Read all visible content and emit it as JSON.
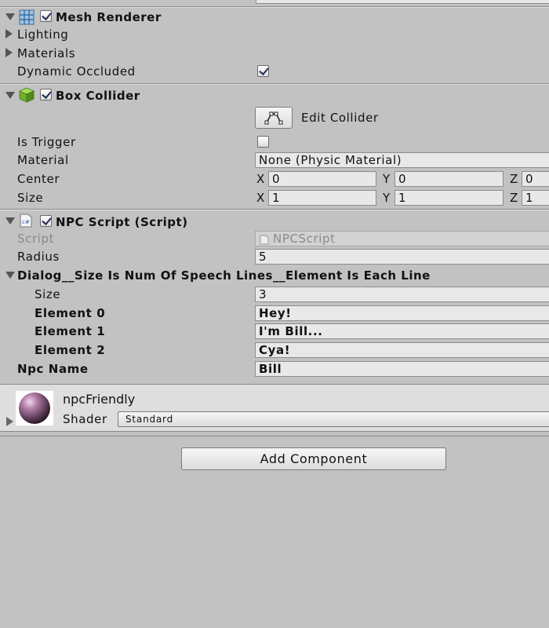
{
  "mesh_renderer": {
    "title": "Mesh Renderer",
    "enabled": true,
    "lighting_label": "Lighting",
    "materials_label": "Materials",
    "dynamic_occluded_label": "Dynamic Occluded",
    "dynamic_occluded": true
  },
  "box_collider": {
    "title": "Box Collider",
    "enabled": true,
    "edit_collider_label": "Edit Collider",
    "is_trigger_label": "Is Trigger",
    "is_trigger": false,
    "material_label": "Material",
    "material_value": "None (Physic Material)",
    "center_label": "Center",
    "center": {
      "x_label": "X",
      "x": "0",
      "y_label": "Y",
      "y": "0",
      "z_label": "Z",
      "z": "0"
    },
    "size_label": "Size",
    "size": {
      "x_label": "X",
      "x": "1",
      "y_label": "Y",
      "y": "1",
      "z_label": "Z",
      "z": "1"
    }
  },
  "npc_script": {
    "title": "NPC Script (Script)",
    "enabled": true,
    "script_label": "Script",
    "script_value": "NPCScript",
    "radius_label": "Radius",
    "radius_value": "5",
    "dialog_label": "Dialog__Size Is Num Of Speech Lines__Element Is Each Line",
    "dialog_size_label": "Size",
    "dialog_size_value": "3",
    "elements": [
      {
        "label": "Element 0",
        "value": "Hey!"
      },
      {
        "label": "Element 1",
        "value": "I'm Bill..."
      },
      {
        "label": "Element 2",
        "value": "Cya!"
      }
    ],
    "npc_name_label": "Npc Name",
    "npc_name_value": "Bill"
  },
  "material_preview": {
    "name": "npcFriendly",
    "shader_label": "Shader",
    "shader_value": "Standard"
  },
  "add_component_label": "Add Component",
  "colors": {
    "panel_bg": "#c2c2c2",
    "sphere": "#b07aa4",
    "collider_cube": "#7fbf3a"
  }
}
